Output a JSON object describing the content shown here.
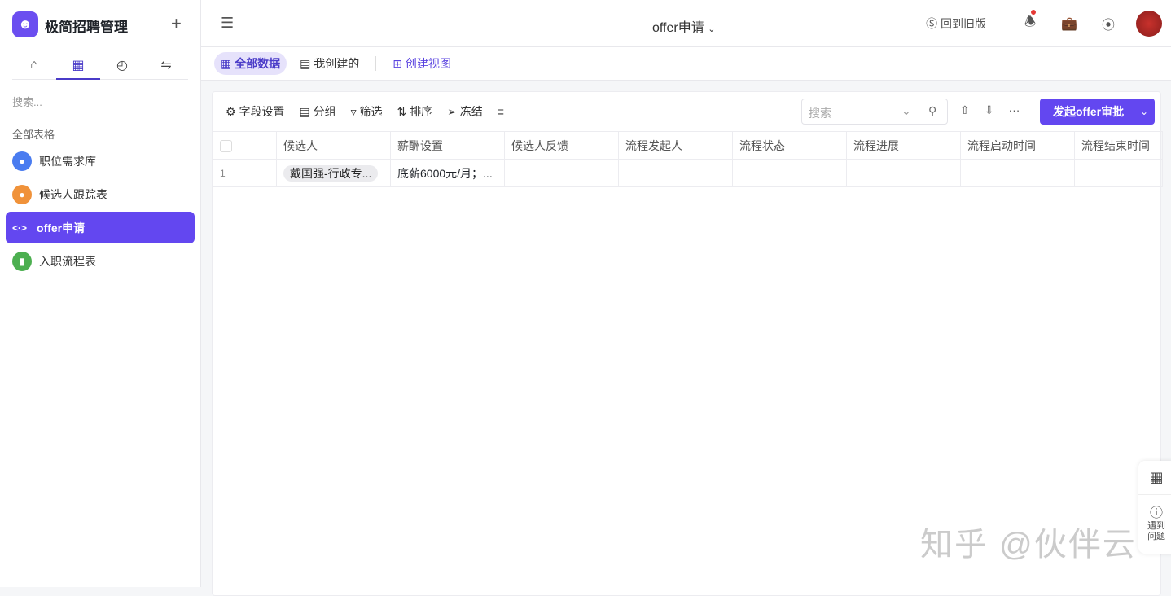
{
  "app": {
    "name": "极简招聘管理",
    "search_placeholder": "搜索...",
    "group_label": "全部表格",
    "tables": [
      {
        "label": "职位需求库",
        "color": "#4a7cf0"
      },
      {
        "label": "候选人跟踪表",
        "color": "#f0923a"
      },
      {
        "label": "offer申请",
        "color": "#6347f0"
      },
      {
        "label": "入职流程表",
        "color": "#4caf50"
      }
    ]
  },
  "header": {
    "title": "offer申请",
    "old_version": "回到旧版"
  },
  "views": {
    "all": "全部数据",
    "mine": "我创建的",
    "create": "创建视图"
  },
  "toolbar": {
    "fields": "字段设置",
    "group": "分组",
    "filter": "筛选",
    "sort": "排序",
    "freeze": "冻结",
    "search_placeholder": "搜索",
    "primary": "发起offer审批"
  },
  "table": {
    "columns": [
      "候选人",
      "薪酬设置",
      "候选人反馈",
      "流程发起人",
      "流程状态",
      "流程进展",
      "流程启动时间",
      "流程结束时间"
    ],
    "rows": [
      {
        "index": "1",
        "candidate": "戴国强-行政专...",
        "salary": "底薪6000元/月；..."
      }
    ]
  },
  "float": {
    "help": "遇到问题"
  },
  "watermark": "知乎 @伙伴云"
}
